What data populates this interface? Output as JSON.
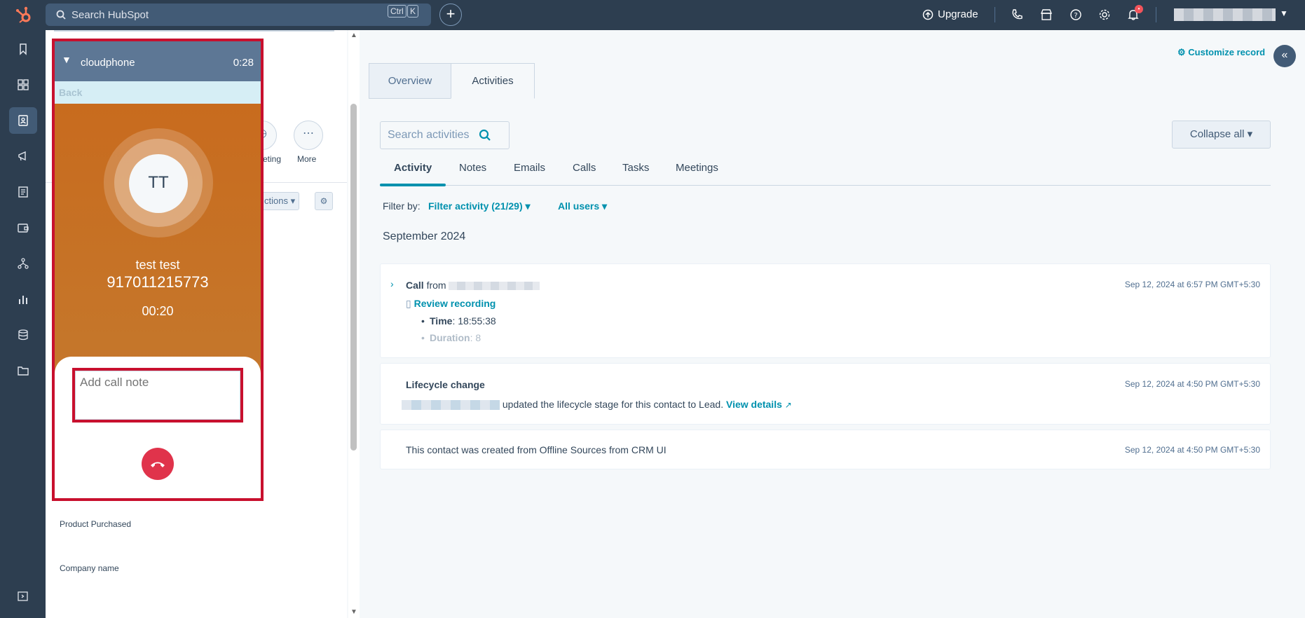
{
  "topbar": {
    "search_placeholder": "Search HubSpot",
    "kbd_ctrl": "Ctrl",
    "kbd_k": "K",
    "upgrade_label": "Upgrade",
    "notification_count": "•"
  },
  "record": {
    "action_more_label": "More",
    "action_partial_label": "eting",
    "actions_dropdown": "ctions",
    "properties": [
      "Product Purchased",
      "Company name"
    ]
  },
  "cloudphone": {
    "title": "cloudphone",
    "timer": "0:28",
    "back_label": "Back",
    "initials": "TT",
    "contact_name": "test test",
    "phone_number": "917011215773",
    "call_duration": "00:20",
    "note_placeholder": "Add call note"
  },
  "activities": {
    "customize_label": "Customize record",
    "tabs": [
      "Overview",
      "Activities"
    ],
    "search_placeholder": "Search activities",
    "collapse_all_label": "Collapse all",
    "subtabs": [
      "Activity",
      "Notes",
      "Emails",
      "Calls",
      "Tasks",
      "Meetings"
    ],
    "filter_by_label": "Filter by:",
    "filter_activity": "Filter activity (21/29)",
    "all_users": "All users",
    "month": "September 2024",
    "cards": [
      {
        "title": "Call",
        "from_label": "from",
        "timestamp": "Sep 12, 2024 at 6:57 PM GMT+5:30",
        "review_label": "Review recording",
        "time_label": "Time",
        "time_value": ": 18:55:38",
        "duration_label": "Duration",
        "duration_value": ": 8"
      },
      {
        "title": "Lifecycle change",
        "timestamp": "Sep 12, 2024 at 4:50 PM GMT+5:30",
        "text": "updated the lifecycle stage for this contact to Lead.",
        "link": "View details"
      },
      {
        "text": "This contact was created from Offline Sources from CRM UI",
        "timestamp": "Sep 12, 2024 at 4:50 PM GMT+5:30"
      }
    ]
  },
  "colors": {
    "nav_bg": "#2d3e50",
    "accent": "#0091ae",
    "hubspot_orange": "#ff7a59",
    "cloudphone_orange": "#c86b1e",
    "highlight_red": "#c8102e",
    "hangup_red": "#e0334b"
  },
  "icons": {
    "left_nav": [
      "bookmark-icon",
      "dashboard-icon",
      "contacts-icon",
      "marketing-icon",
      "content-icon",
      "commerce-icon",
      "automation-icon",
      "reports-icon",
      "data-icon",
      "library-icon",
      "expand-icon"
    ],
    "top_right": [
      "phone-icon",
      "marketplace-icon",
      "help-icon",
      "settings-icon",
      "notifications-icon"
    ]
  }
}
